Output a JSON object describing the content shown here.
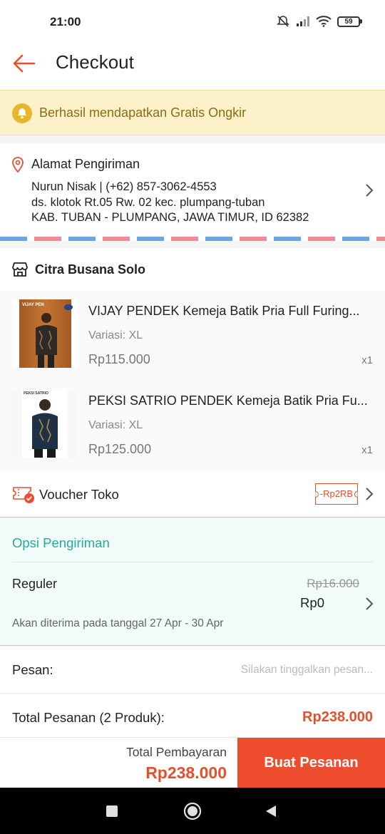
{
  "status_bar": {
    "time": "21:00",
    "battery": "59"
  },
  "header": {
    "title": "Checkout"
  },
  "banner": {
    "text": "Berhasil mendapatkan Gratis Ongkir"
  },
  "address": {
    "title": "Alamat Pengiriman",
    "line1": "Nurun Nisak | (+62) 857-3062-4553",
    "line2": "ds. klotok Rt.05 Rw. 02 kec. plumpang-tuban",
    "line3": "KAB. TUBAN - PLUMPANG, JAWA TIMUR, ID 62382"
  },
  "shop": {
    "name": "Citra Busana Solo"
  },
  "products": [
    {
      "name": "VIJAY PENDEK Kemeja Batik Pria Full Furing...",
      "variant": "Variasi: XL",
      "price": "Rp115.000",
      "qty": "x1",
      "thumb_caption": "VIJAY PEN"
    },
    {
      "name": "PEKSI SATRIO PENDEK Kemeja Batik Pria Fu...",
      "variant": "Variasi: XL",
      "price": "Rp125.000",
      "qty": "x1",
      "thumb_caption": "PEKSI SATRIO"
    }
  ],
  "voucher": {
    "label": "Voucher Toko",
    "tag": "-Rp2RB"
  },
  "shipping": {
    "title": "Opsi Pengiriman",
    "method": "Reguler",
    "original_price": "Rp16.000",
    "price": "Rp0",
    "eta": "Akan diterima pada tanggal 27 Apr - 30 Apr"
  },
  "message": {
    "label": "Pesan:",
    "placeholder": "Silakan tinggalkan pesan..."
  },
  "order_total": {
    "label": "Total Pesanan (2 Produk):",
    "value": "Rp238.000"
  },
  "bottom_bar": {
    "payment_label": "Total Pembayaran",
    "payment_total": "Rp238.000",
    "place_order_label": "Buat Pesanan"
  },
  "colors": {
    "brand": "#ee4d2d",
    "accent_teal": "#26aa99",
    "banner_bg": "#fdf1c9"
  },
  "icons": {
    "back": "arrow-left-icon",
    "bell": "bell-icon",
    "pin": "location-pin-icon",
    "shop": "store-icon",
    "voucher": "voucher-icon",
    "chevron": "chevron-right-icon"
  }
}
